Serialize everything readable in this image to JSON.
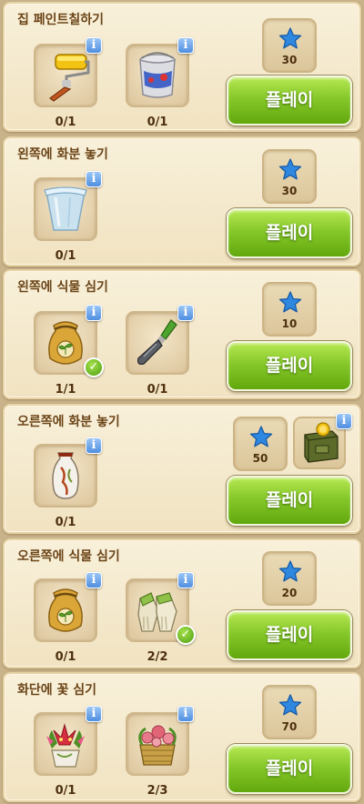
{
  "colors": {
    "panel": "#f4e9cf",
    "title_text": "#6b4417",
    "play_button": "#7cc21f",
    "star": "#2f88e0",
    "info_badge": "#5b97e3",
    "check_badge": "#5cae15"
  },
  "tasks": [
    {
      "title": "집 페인트칠하기",
      "items": [
        {
          "icon": "paint-roller-icon",
          "count": "0/1",
          "done": false
        },
        {
          "icon": "paint-bucket-icon",
          "count": "0/1",
          "done": false
        }
      ],
      "reward": "30",
      "play": "플레이"
    },
    {
      "title": "왼쪽에 화분 놓기",
      "items": [
        {
          "icon": "flower-pot-icon",
          "count": "0/1",
          "done": false
        }
      ],
      "reward": "30",
      "play": "플레이"
    },
    {
      "title": "왼쪽에 식물 심기",
      "items": [
        {
          "icon": "seed-bag-icon",
          "count": "1/1",
          "done": true
        },
        {
          "icon": "trowel-icon",
          "count": "0/1",
          "done": false
        }
      ],
      "reward": "10",
      "play": "플레이"
    },
    {
      "title": "오른쪽에 화분 놓기",
      "items": [
        {
          "icon": "vase-icon",
          "count": "0/1",
          "done": false
        }
      ],
      "reward": "50",
      "bonus_icon": "supply-crate-icon",
      "play": "플레이"
    },
    {
      "title": "오른쪽에 식물 심기",
      "items": [
        {
          "icon": "seed-bag-icon",
          "count": "0/1",
          "done": false
        },
        {
          "icon": "garden-gloves-icon",
          "count": "2/2",
          "done": true
        }
      ],
      "reward": "20",
      "play": "플레이"
    },
    {
      "title": "화단에 꽃 심기",
      "items": [
        {
          "icon": "lily-bouquet-icon",
          "count": "0/1",
          "done": false
        },
        {
          "icon": "rose-basket-icon",
          "count": "2/3",
          "done": false
        }
      ],
      "reward": "70",
      "play": "플레이"
    }
  ]
}
